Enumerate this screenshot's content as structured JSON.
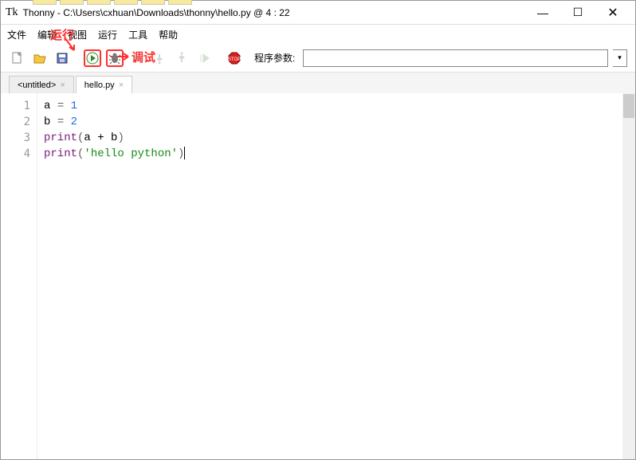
{
  "title": "Thonny  -  C:\\Users\\cxhuan\\Downloads\\thonny\\hello.py  @  4 : 22",
  "menu": {
    "file": "文件",
    "edit": "编辑",
    "view": "视图",
    "run": "运行",
    "tools": "工具",
    "help": "帮助"
  },
  "toolbar": {
    "param_label": "程序参数:",
    "param_value": ""
  },
  "annotations": {
    "run": "运行",
    "debug": "调试"
  },
  "tabs": [
    {
      "label": "<untitled>",
      "active": false
    },
    {
      "label": "hello.py",
      "active": true
    }
  ],
  "code": {
    "lines": [
      {
        "n": 1,
        "tokens": [
          [
            "var",
            "a"
          ],
          [
            "sp",
            " "
          ],
          [
            "op",
            "="
          ],
          [
            "sp",
            " "
          ],
          [
            "num",
            "1"
          ]
        ]
      },
      {
        "n": 2,
        "tokens": [
          [
            "var",
            "b"
          ],
          [
            "sp",
            " "
          ],
          [
            "op",
            "="
          ],
          [
            "sp",
            " "
          ],
          [
            "num",
            "2"
          ]
        ]
      },
      {
        "n": 3,
        "tokens": [
          [
            "fn",
            "print"
          ],
          [
            "op",
            "("
          ],
          [
            "var",
            "a"
          ],
          [
            "sp",
            " "
          ],
          [
            "var",
            "+"
          ],
          [
            "sp",
            " "
          ],
          [
            "var",
            "b"
          ],
          [
            "op",
            ")"
          ]
        ]
      },
      {
        "n": 4,
        "tokens": [
          [
            "fn",
            "print"
          ],
          [
            "op",
            "("
          ],
          [
            "str",
            "'hello python'"
          ],
          [
            "op",
            ")"
          ],
          [
            "cursor",
            ""
          ]
        ]
      }
    ]
  }
}
